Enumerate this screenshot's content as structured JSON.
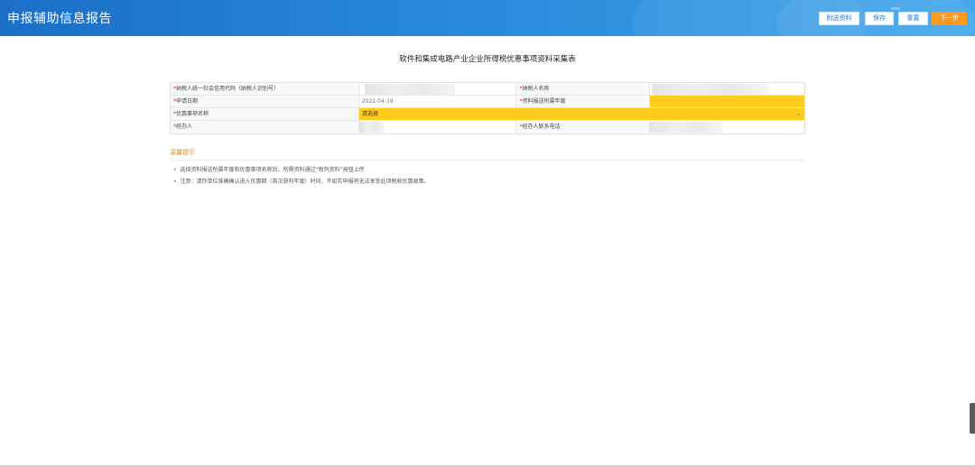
{
  "header": {
    "title": "申报辅助信息报告",
    "buttons": {
      "attach": "附送资料",
      "save": "保存",
      "reset": "重置",
      "next": "下一步"
    }
  },
  "page_title": "软件和集成电路产业企业所得税优惠事项资料采集表",
  "form": {
    "taxpayer_id_label": "纳税人统一社会信用代码（纳税人识别号）",
    "taxpayer_name_label": "纳税人名称",
    "apply_date_label": "申请日期",
    "apply_date_value": "2022-04-19",
    "report_year_label": "资料报送所属年度",
    "item_name_label": "优惠事项名称",
    "item_name_placeholder": "请选择",
    "handler_label": "经办人",
    "handler_phone_label": "经办人联系电话",
    "required_mark": "*"
  },
  "tips": {
    "title": "温馨提示",
    "items": [
      "选择资料报送所属年度和优惠事项名称后，所需资料通过“附列资料”按钮上传",
      "注意：请你单位准确确认进入优惠期（首次获利年度）时间，不如实申报将无法享受此项税收优惠政策。"
    ],
    "bullet": "•"
  },
  "colors": {
    "header_blue": "#1b6fc6",
    "accent_orange": "#ff9a1f",
    "highlight_yellow": "#ffcc1e",
    "required_red": "#e02020"
  }
}
